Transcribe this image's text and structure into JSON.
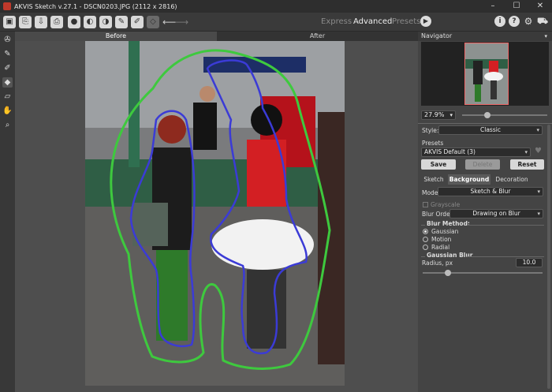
{
  "window": {
    "title": "AKVIS Sketch v.27.1 - DSCN0203.JPG (2112 x 2816)",
    "controls": [
      "–",
      "☐",
      "✕"
    ]
  },
  "toolbar": {
    "modes": [
      "Express",
      "Advanced",
      "Presets"
    ],
    "active_mode": "Advanced",
    "icons": [
      "open-icon",
      "save-icon",
      "print-icon",
      "share-icon",
      "undo-icon",
      "redo-icon"
    ]
  },
  "canvas": {
    "tabs": [
      "Before",
      "After"
    ],
    "active_tab": "Before"
  },
  "navigator": {
    "title": "Navigator",
    "zoom": "27.9%"
  },
  "settings": {
    "style_label": "Style:",
    "style_value": "Classic",
    "presets_label": "Presets",
    "preset_value": "AKVIS Default (3)",
    "save": "Save",
    "delete": "Delete",
    "reset": "Reset",
    "subtabs": [
      "Sketch",
      "Background",
      "Decoration"
    ],
    "active_subtab": "Background",
    "mode_label": "Mode:",
    "mode_value": "Sketch & Blur",
    "grayscale": "Grayscale",
    "blur_order_label": "Blur Order:",
    "blur_order_value": "Drawing on Blur",
    "blur_method_label": "Blur Method:",
    "blur_methods": [
      "Gaussian",
      "Motion",
      "Radial"
    ],
    "blur_method_selected": "Gaussian",
    "gaussian_title": "Gaussian Blur",
    "radius_label": "Radius, px",
    "radius_value": "10.0"
  },
  "colors": {
    "green_stroke": "#3ec93e",
    "blue_stroke": "#3b3bd6"
  }
}
